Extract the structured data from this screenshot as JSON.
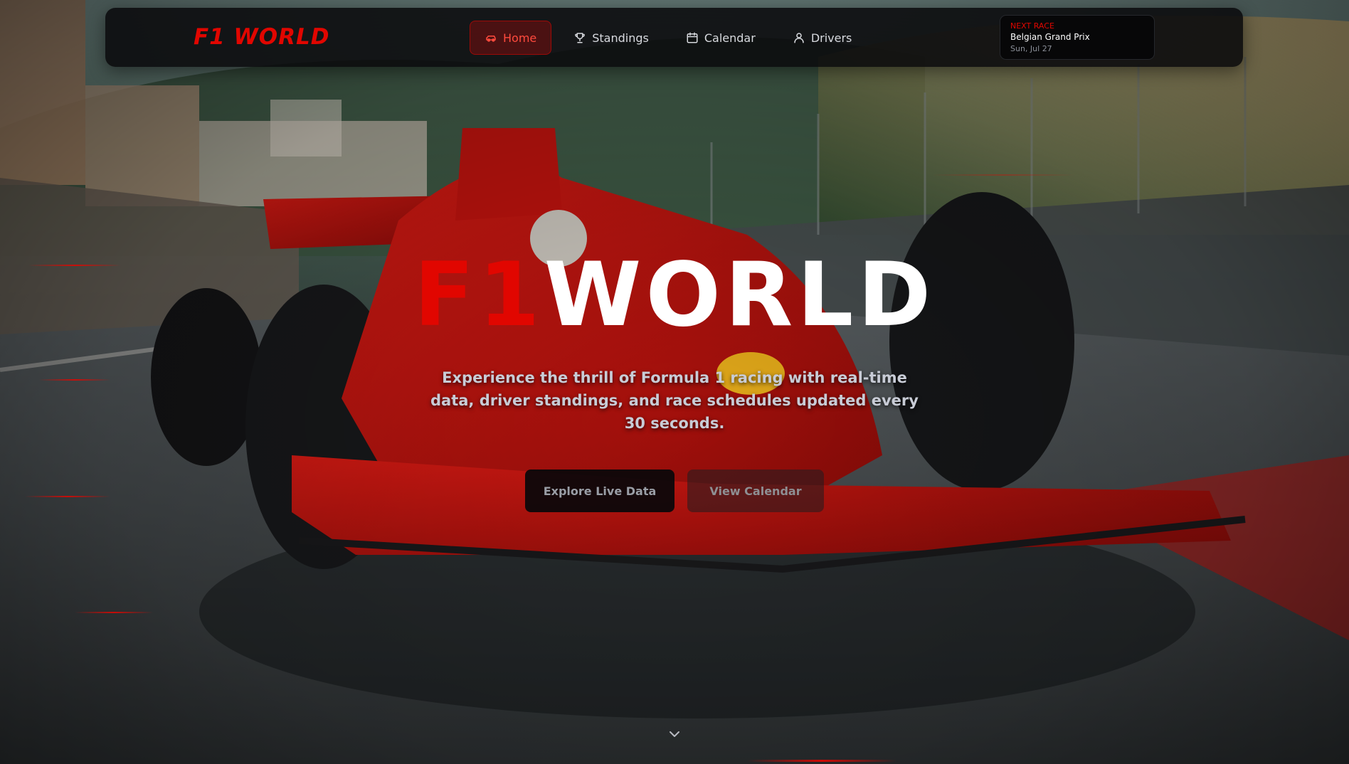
{
  "nav": {
    "logo": "F1 WORLD",
    "links": [
      {
        "label": "Home",
        "icon": "car-icon",
        "active": true
      },
      {
        "label": "Standings",
        "icon": "trophy-icon",
        "active": false
      },
      {
        "label": "Calendar",
        "icon": "calendar-icon",
        "active": false
      },
      {
        "label": "Drivers",
        "icon": "user-icon",
        "active": false
      }
    ],
    "next_race": {
      "label": "NEXT RACE",
      "name": "Belgian Grand Prix",
      "date": "Sun, Jul 27"
    }
  },
  "hero": {
    "title_part1": "F1",
    "title_part2": "WORLD",
    "subtitle": "Experience the thrill of Formula 1 racing with real-time data, driver standings, and race schedules updated every 30 seconds.",
    "primary_button": "Explore Live Data",
    "secondary_button": "View Calendar",
    "scroll_icon": "chevron-down-icon",
    "background": "racing-car-photo"
  },
  "colors": {
    "accent": "#e10600",
    "background": "#0b0c0e",
    "text": "#ffffff",
    "muted": "#c8ccd6"
  }
}
